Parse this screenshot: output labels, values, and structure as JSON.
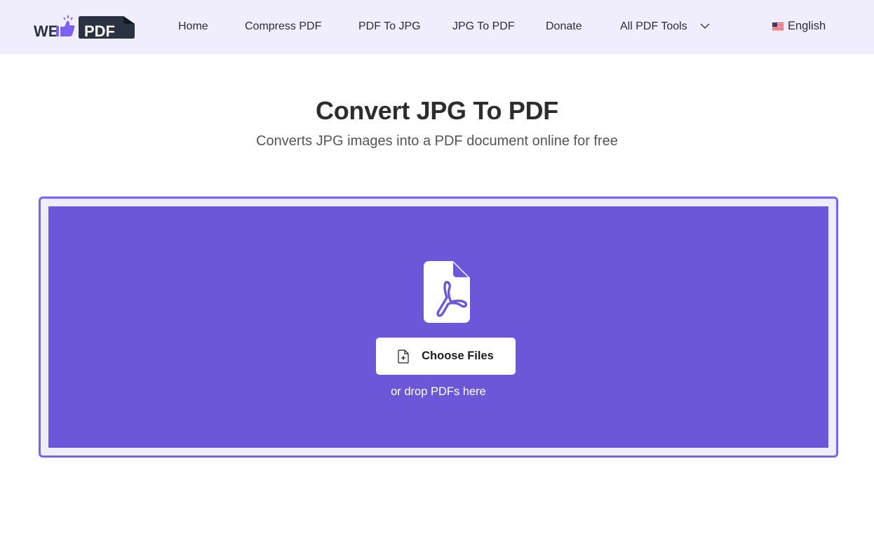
{
  "header": {
    "logo_text_left": "WE",
    "logo_text_right": "PDF",
    "nav": [
      {
        "label": "Home"
      },
      {
        "label": "Compress PDF"
      },
      {
        "label": "PDF To JPG"
      },
      {
        "label": "JPG To PDF"
      },
      {
        "label": "Donate"
      },
      {
        "label": "All PDF Tools"
      }
    ],
    "language": "English"
  },
  "main": {
    "title": "Convert JPG To PDF",
    "subtitle": "Converts JPG images into a PDF document online for free"
  },
  "upload": {
    "choose_label": "Choose Files",
    "drop_hint": "or drop PDFs here"
  },
  "colors": {
    "nav_bg": "#f0eefd",
    "accent": "#6b57d8",
    "border": "#7a63f0"
  }
}
